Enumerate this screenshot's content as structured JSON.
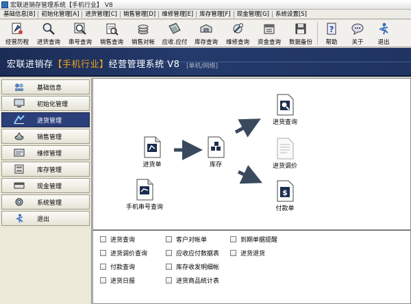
{
  "window": {
    "title": "宏联进销存管理系统【手机行业】 V8"
  },
  "menu": [
    "基础信息[B]",
    "初始化管理[A]",
    "进货管理[C]",
    "销售管理[D]",
    "维修管理[E]",
    "库存管理[F]",
    "现金管理[G]",
    "系统设置[S]"
  ],
  "toolbar": [
    {
      "label": "经营历程",
      "icon": "history-icon"
    },
    {
      "label": "进货查询",
      "icon": "search-icon"
    },
    {
      "label": "串号查询",
      "icon": "magnifier-icon"
    },
    {
      "label": "销售查询",
      "icon": "sales-icon"
    },
    {
      "label": "销售对帐",
      "icon": "coins-icon"
    },
    {
      "label": "应收.应付",
      "icon": "ledger-icon"
    },
    {
      "label": "库存查询",
      "icon": "inventory-icon"
    },
    {
      "label": "维修查询",
      "icon": "repair-icon"
    },
    {
      "label": "资金查询",
      "icon": "funds-icon"
    },
    {
      "label": "数据备份",
      "icon": "disk-icon"
    },
    {
      "label": "帮助",
      "icon": "help-icon"
    },
    {
      "label": "关于",
      "icon": "about-icon"
    },
    {
      "label": "退出",
      "icon": "exit-icon"
    }
  ],
  "banner": {
    "prefix": "宏联进销存",
    "bracket_open": "【",
    "industry": "手机行业",
    "bracket_close": "】",
    "suffix": "经营管理系统 V8",
    "mode": "[单机/网络]"
  },
  "sidebar": [
    {
      "label": "基础信息",
      "icon": "basic-info-icon",
      "active": false
    },
    {
      "label": "初始化管理",
      "icon": "monitor-icon",
      "active": false
    },
    {
      "label": "进货管理",
      "icon": "purchase-icon",
      "active": true
    },
    {
      "label": "销售管理",
      "icon": "sales-icon",
      "active": false
    },
    {
      "label": "维修管理",
      "icon": "repair-icon",
      "active": false
    },
    {
      "label": "库存管理",
      "icon": "warehouse-icon",
      "active": false
    },
    {
      "label": "现金管理",
      "icon": "cash-icon",
      "active": false
    },
    {
      "label": "系统管理",
      "icon": "settings-icon",
      "active": false
    },
    {
      "label": "退出",
      "icon": "exit-icon",
      "active": false
    }
  ],
  "flow": {
    "purchase_order": "进货单",
    "imei_query": "手机串号查询",
    "stock": "库存",
    "purchase_query": "进货查询",
    "price_adjust": "进货调价",
    "payment": "付款单"
  },
  "quicklinks": [
    "进货查询",
    "进货调价查询",
    "付款查询",
    "进货日报",
    "客户对帐单",
    "应收应付数据表",
    "库存收发明细帐",
    "进货商品统计表",
    "到期单据提醒",
    "进货退货"
  ],
  "colors": {
    "banner": "#1f3462",
    "accent": "#f3a21c",
    "active_item": "#2b3f7a"
  }
}
